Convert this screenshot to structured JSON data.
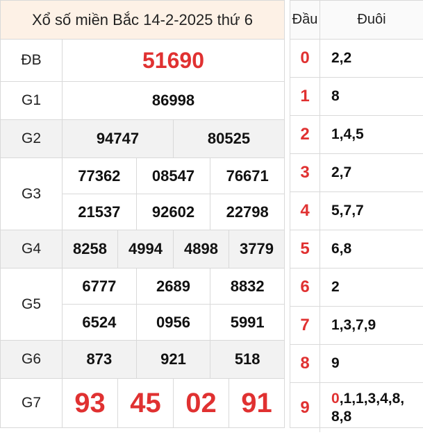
{
  "title": "Xổ số miền Bắc 14-2-2025 thứ 6",
  "prizes": {
    "db": {
      "label": "ĐB",
      "numbers": [
        "51690"
      ]
    },
    "g1": {
      "label": "G1",
      "numbers": [
        "86998"
      ]
    },
    "g2": {
      "label": "G2",
      "numbers": [
        "94747",
        "80525"
      ]
    },
    "g3": {
      "label": "G3",
      "numbers": [
        "77362",
        "08547",
        "76671",
        "21537",
        "92602",
        "22798"
      ]
    },
    "g4": {
      "label": "G4",
      "numbers": [
        "8258",
        "4994",
        "4898",
        "3779"
      ]
    },
    "g5": {
      "label": "G5",
      "numbers": [
        "6777",
        "2689",
        "8832",
        "6524",
        "0956",
        "5991"
      ]
    },
    "g6": {
      "label": "G6",
      "numbers": [
        "873",
        "921",
        "518"
      ]
    },
    "g7": {
      "label": "G7",
      "numbers": [
        "93",
        "45",
        "02",
        "91"
      ]
    }
  },
  "loto": {
    "header_dau": "Đầu",
    "header_duoi": "Đuôi",
    "rows": [
      {
        "dau": "0",
        "duoi": "2,2"
      },
      {
        "dau": "1",
        "duoi": "8"
      },
      {
        "dau": "2",
        "duoi": "1,4,5"
      },
      {
        "dau": "3",
        "duoi": "2,7"
      },
      {
        "dau": "4",
        "duoi": "5,7,7"
      },
      {
        "dau": "5",
        "duoi": "6,8"
      },
      {
        "dau": "6",
        "duoi": "2"
      },
      {
        "dau": "7",
        "duoi": "1,3,7,9"
      },
      {
        "dau": "8",
        "duoi": "9"
      },
      {
        "dau": "9",
        "duoi_red": "0",
        "duoi": ",1,1,3,4,8,",
        "duoi_line2": "8,8"
      }
    ]
  },
  "colors": {
    "accent_red": "#e03131",
    "header_bg": "#fdf1e6",
    "alt_row_bg": "#f2f2f2"
  }
}
